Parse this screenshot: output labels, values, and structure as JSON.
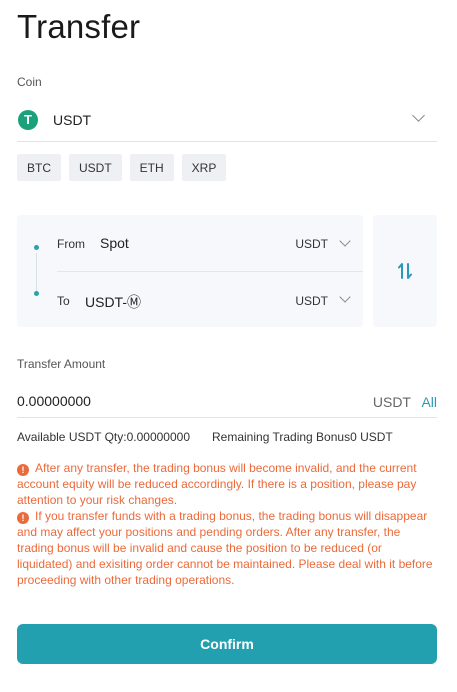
{
  "header": {
    "title": "Transfer"
  },
  "coin": {
    "label": "Coin",
    "selected": "USDT",
    "logo_glyph": "T",
    "logo_color": "#1ba27a",
    "quick_picks": [
      "BTC",
      "USDT",
      "ETH",
      "XRP"
    ]
  },
  "transfer": {
    "from_label": "From",
    "from_account": "Spot",
    "from_coin": "USDT",
    "to_label": "To",
    "to_account": "USDT-Ⓜ",
    "to_coin": "USDT",
    "swap_icon": "swap-vertical-icon",
    "accent": "#2da1ab"
  },
  "amount": {
    "label": "Transfer Amount",
    "value": "0.00000000",
    "unit": "USDT",
    "all_label": "All"
  },
  "info": {
    "available": "Available USDT Qty:0.00000000",
    "bonus": "Remaining Trading Bonus0 USDT"
  },
  "warnings": [
    "After any transfer, the trading bonus will become invalid, and the current account equity will be reduced accordingly. If there is a position, please pay attention to your risk changes.",
    "If you transfer funds with a trading bonus, the trading bonus will disappear and may affect your positions and pending orders. After any transfer, the trading bonus will be invalid and cause the position to be reduced (or liquidated) and exisiting order cannot be maintained. Please deal with it before proceeding with other trading operations."
  ],
  "warning_color": "#ec6a3a",
  "confirm_label": "Confirm",
  "confirm_color": "#23a0b0"
}
